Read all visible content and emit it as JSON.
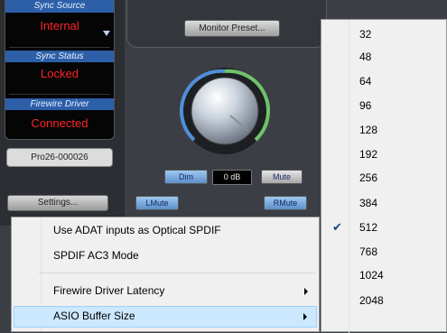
{
  "device_panel": {
    "sync_source_label": "Sync Source",
    "sync_source_value": "Internal",
    "sync_status_label": "Sync Status",
    "sync_status_value": "Locked",
    "firewire_driver_label": "Firewire Driver",
    "firewire_driver_value": "Connected",
    "serial": "Pro26-000026",
    "settings_label": "Settings..."
  },
  "monitor": {
    "preset_label": "Monitor Preset...",
    "dim_label": "Dim",
    "level_display": "0 dB",
    "mute_label": "Mute",
    "lmute_label": "LMute",
    "rmute_label": "RMute"
  },
  "menu": {
    "items": [
      {
        "label": "Use ADAT inputs as Optical SPDIF"
      },
      {
        "label": "SPDIF AC3 Mode"
      },
      {
        "label": "Firewire Driver Latency"
      },
      {
        "label": "ASIO Buffer Size"
      }
    ]
  },
  "submenu": {
    "items": [
      {
        "label": "32"
      },
      {
        "label": "48"
      },
      {
        "label": "64"
      },
      {
        "label": "96"
      },
      {
        "label": "128"
      },
      {
        "label": "192"
      },
      {
        "label": "256"
      },
      {
        "label": "384"
      },
      {
        "label": "512",
        "checked": true
      },
      {
        "label": "768"
      },
      {
        "label": "1024"
      },
      {
        "label": "2048"
      }
    ]
  },
  "colors": {
    "status_red": "#ff2626",
    "highlight": "#cce8ff",
    "knob_ring_green": "#6fc36a",
    "knob_ring_blue": "#4f8fd8"
  }
}
